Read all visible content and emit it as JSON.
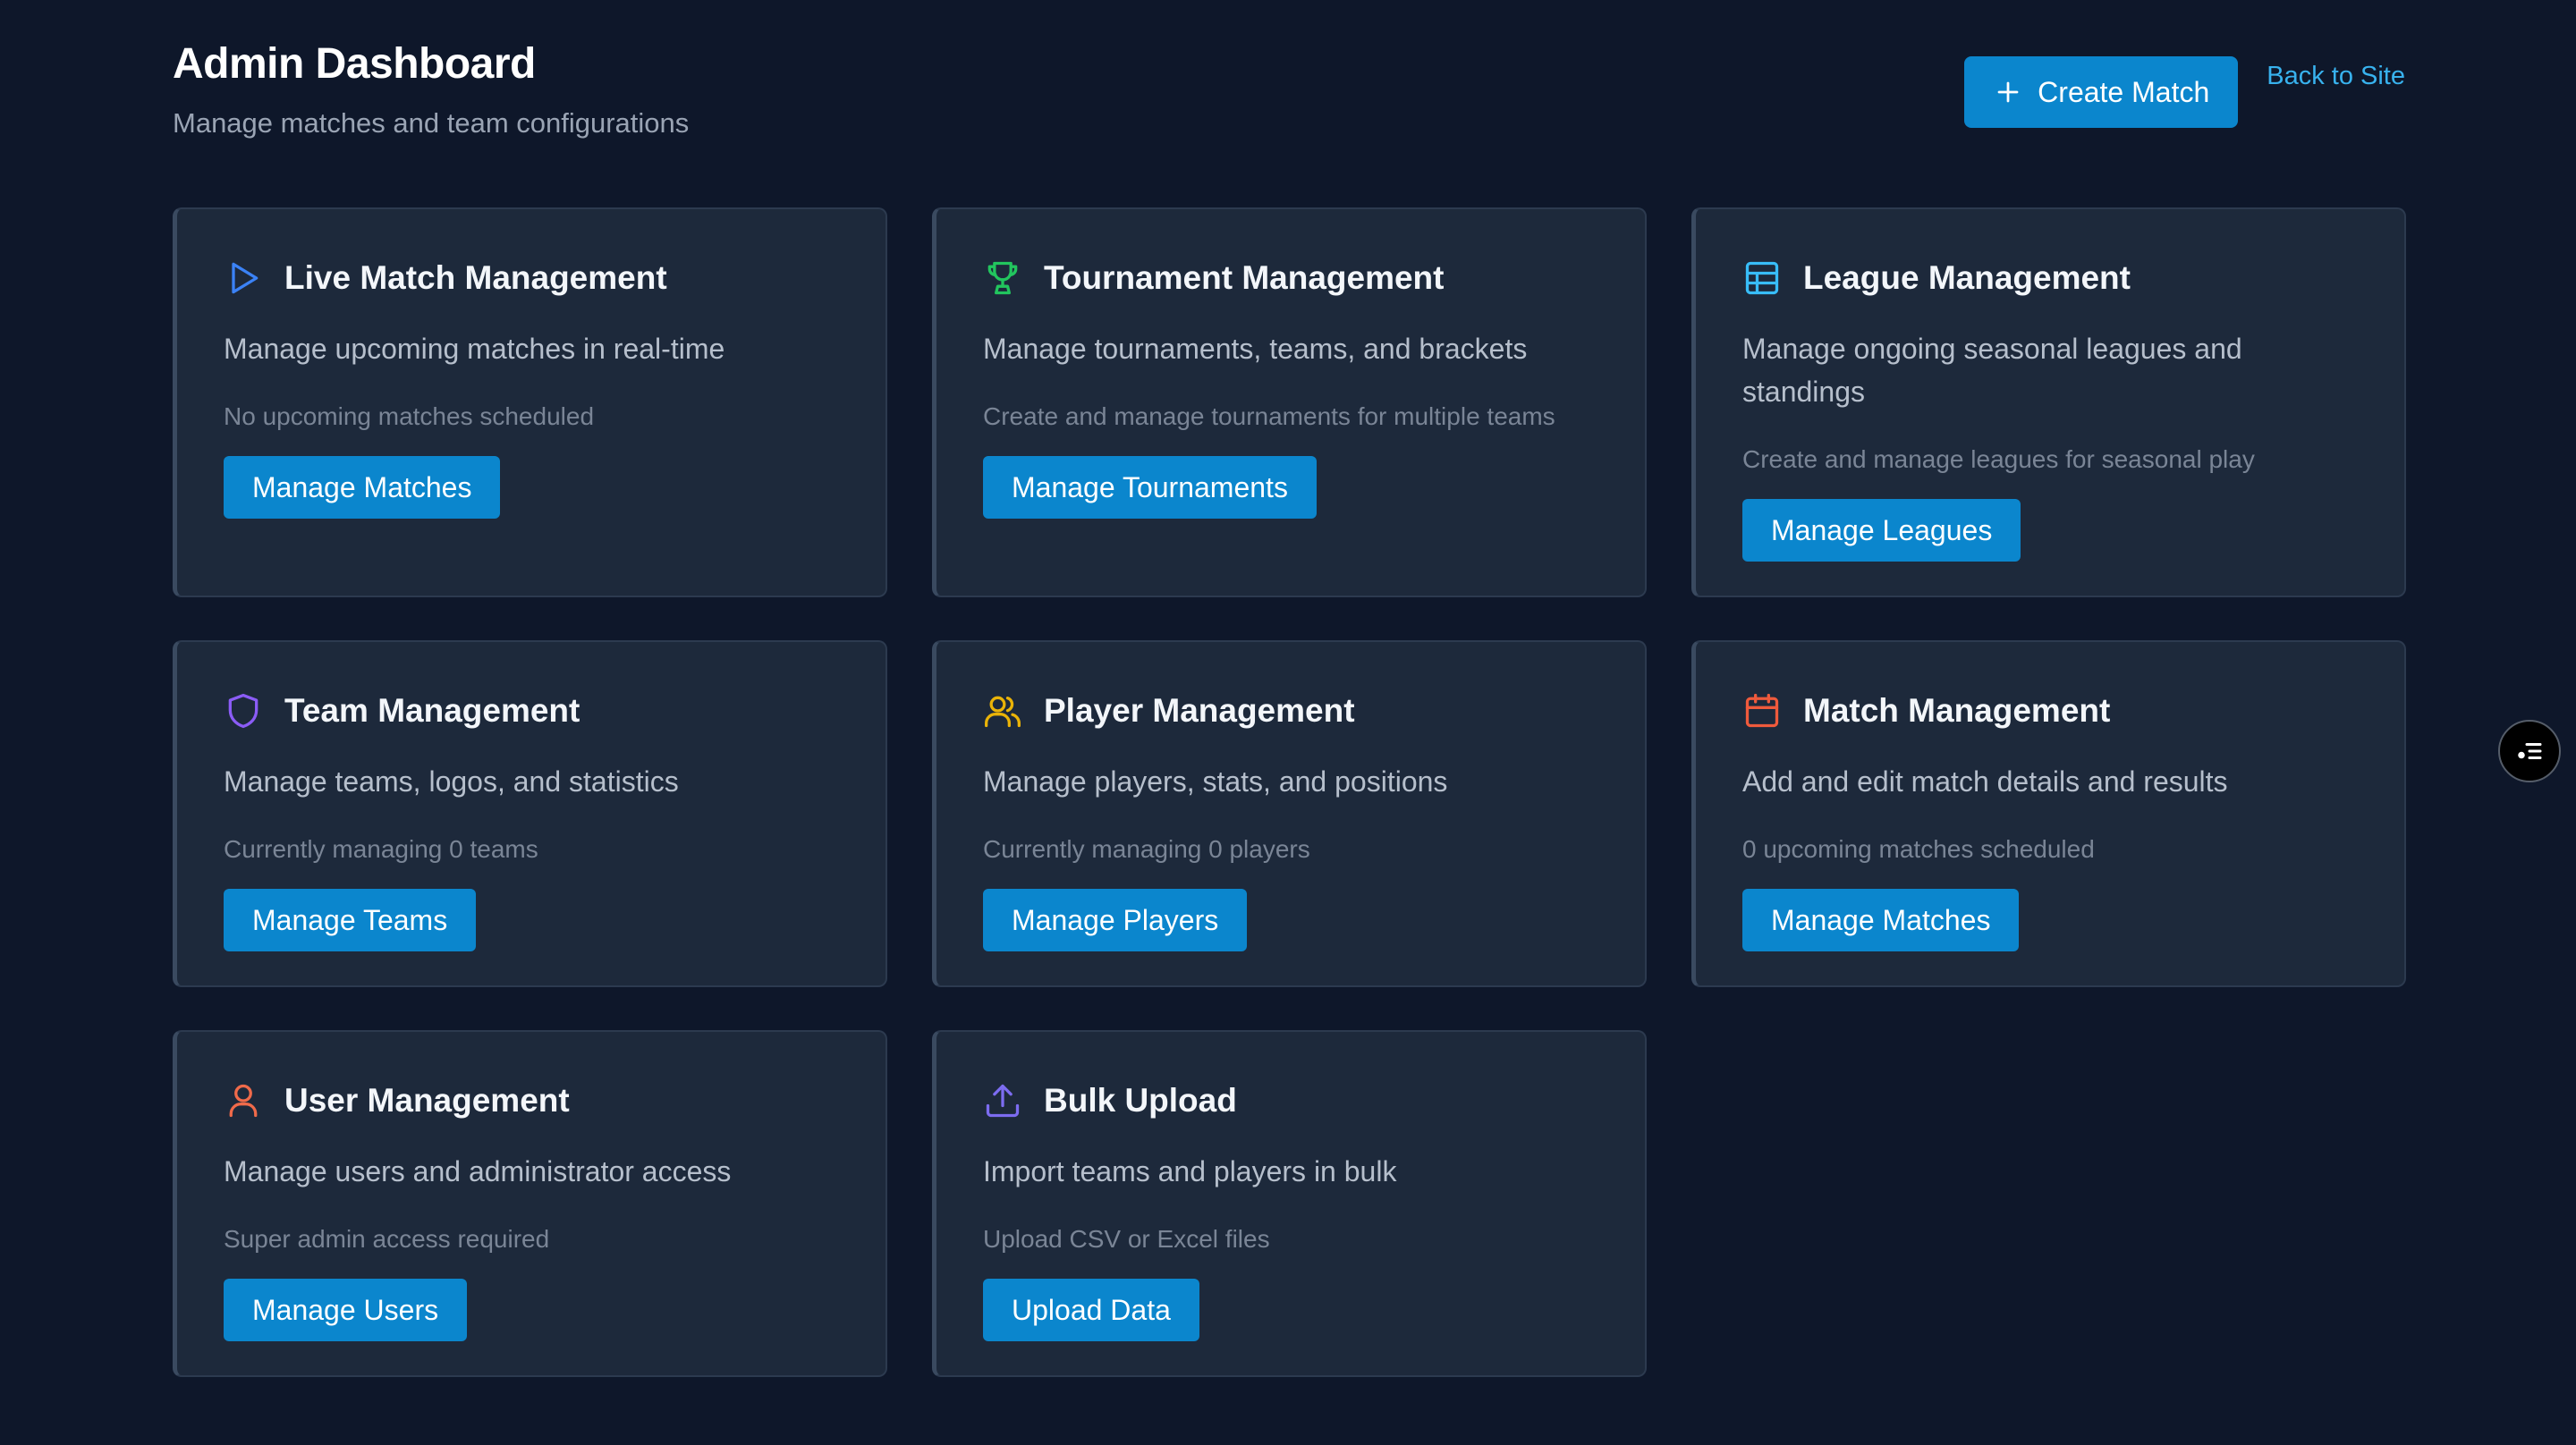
{
  "header": {
    "title": "Admin Dashboard",
    "subtitle": "Manage matches and team configurations",
    "create_label": "Create Match",
    "back_label": "Back to Site"
  },
  "cards": [
    {
      "icon": "play-icon",
      "color": "#3b82f6",
      "title": "Live Match Management",
      "description": "Manage upcoming matches in real-time",
      "note": "No upcoming matches scheduled",
      "button": "Manage Matches"
    },
    {
      "icon": "trophy-icon",
      "color": "#22c55e",
      "title": "Tournament Management",
      "description": "Manage tournaments, teams, and brackets",
      "note": "Create and manage tournaments for multiple teams",
      "button": "Manage Tournaments"
    },
    {
      "icon": "table-icon",
      "color": "#38bdf8",
      "title": "League Management",
      "description": "Manage ongoing seasonal leagues and standings",
      "note": "Create and manage leagues for seasonal play",
      "button": "Manage Leagues"
    },
    {
      "icon": "shield-icon",
      "color": "#8b5cf6",
      "title": "Team Management",
      "description": "Manage teams, logos, and statistics",
      "note": "Currently managing 0 teams",
      "button": "Manage Teams"
    },
    {
      "icon": "users-icon",
      "color": "#eab308",
      "title": "Player Management",
      "description": "Manage players, stats, and positions",
      "note": "Currently managing 0 players",
      "button": "Manage Players"
    },
    {
      "icon": "calendar-icon",
      "color": "#ef5a3c",
      "title": "Match Management",
      "description": "Add and edit match details and results",
      "note": "0 upcoming matches scheduled",
      "button": "Manage Matches"
    },
    {
      "icon": "user-icon",
      "color": "#f06a4a",
      "title": "User Management",
      "description": "Manage users and administrator access",
      "note": "Super admin access required",
      "button": "Manage Users"
    },
    {
      "icon": "upload-icon",
      "color": "#7c6cf0",
      "title": "Bulk Upload",
      "description": "Import teams and players in bulk",
      "note": "Upload CSV or Excel files",
      "button": "Upload Data"
    }
  ],
  "floating": {
    "icon": "toolbar-toggle-icon"
  }
}
